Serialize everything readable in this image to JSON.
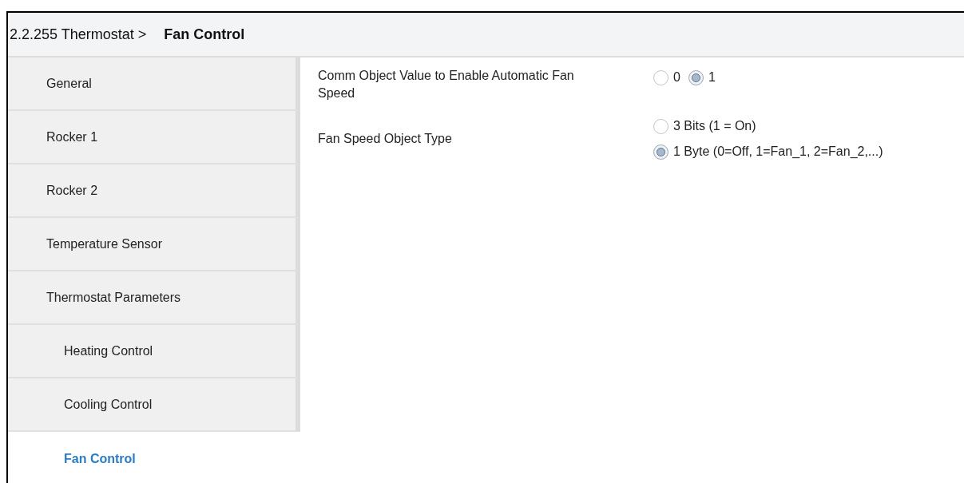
{
  "breadcrumb": {
    "parent": "2.2.255 Thermostat >",
    "current": "Fan Control"
  },
  "sidebar": {
    "items": [
      {
        "label": "General",
        "selected": false
      },
      {
        "label": "Rocker 1",
        "selected": false
      },
      {
        "label": "Rocker 2",
        "selected": false
      },
      {
        "label": "Temperature Sensor",
        "selected": false
      },
      {
        "label": "Thermostat Parameters",
        "selected": false,
        "children": [
          {
            "label": "Heating Control",
            "selected": false
          },
          {
            "label": "Cooling Control",
            "selected": false
          },
          {
            "label": "Fan Control",
            "selected": true
          }
        ]
      }
    ]
  },
  "parameters": [
    {
      "label": "Comm Object Value to Enable Automatic Fan Speed",
      "kind": "inline",
      "options": [
        {
          "label": "0",
          "selected": false
        },
        {
          "label": "1",
          "selected": true
        }
      ]
    },
    {
      "label": "Fan Speed Object Type",
      "kind": "stacked",
      "options": [
        {
          "label": "3 Bits (1 = On)",
          "selected": false
        },
        {
          "label": "1 Byte (0=Off, 1=Fan_1, 2=Fan_2,...)",
          "selected": true
        }
      ]
    }
  ]
}
